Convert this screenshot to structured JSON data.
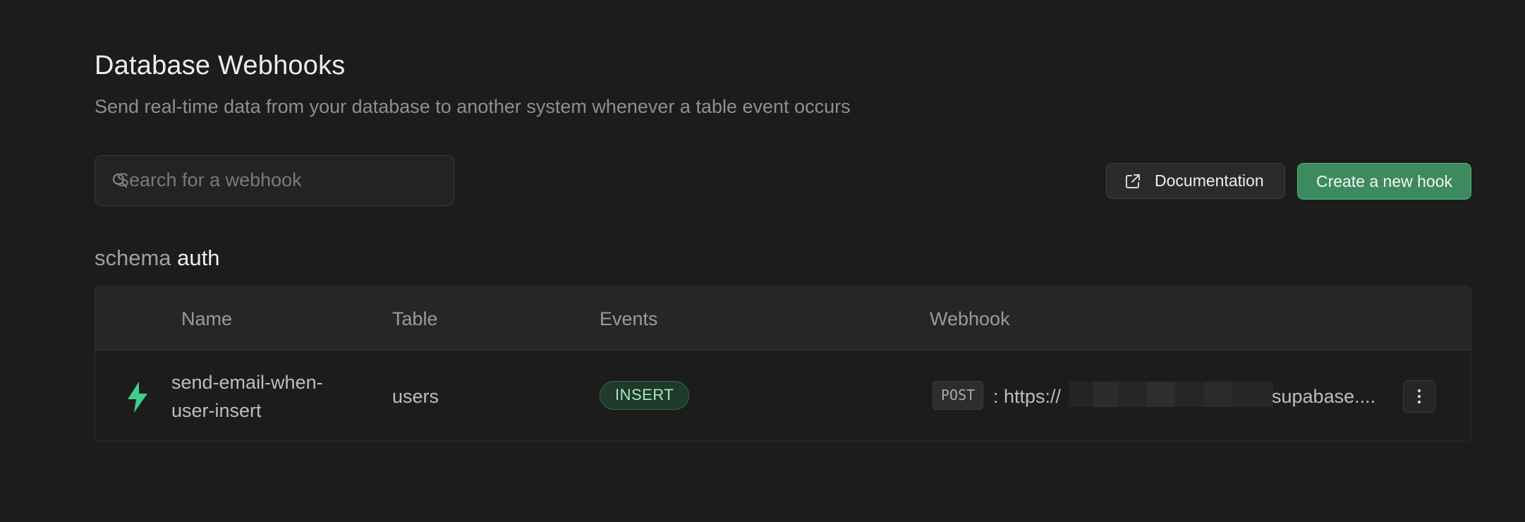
{
  "header": {
    "title": "Database Webhooks",
    "subtitle": "Send real-time data from your database to another system whenever a table event occurs"
  },
  "search": {
    "placeholder": "Search for a webhook",
    "value": ""
  },
  "actions": {
    "documentation_label": "Documentation",
    "create_label": "Create a new hook"
  },
  "schema": {
    "prefix": "schema",
    "name": "auth"
  },
  "table": {
    "columns": [
      "Name",
      "Table",
      "Events",
      "Webhook"
    ],
    "rows": [
      {
        "icon": "bolt-icon",
        "name": "send-email-when-user-insert",
        "name_line1": "send-email-when-",
        "name_line2": "user-insert",
        "table": "users",
        "event": "INSERT",
        "method": "POST",
        "url_prefix": ": https://",
        "url_suffix": "supabase...."
      }
    ]
  },
  "colors": {
    "accent": "#3d8a5f",
    "accent_border": "#52b57c",
    "bolt": "#3ecf8e",
    "background": "#1c1c1c"
  }
}
